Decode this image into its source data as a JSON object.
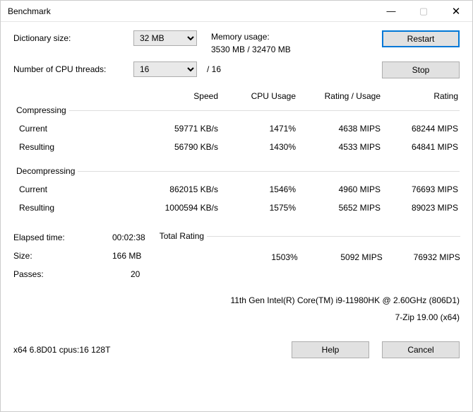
{
  "titlebar": {
    "text": "Benchmark"
  },
  "labels": {
    "dict_size": "Dictionary size:",
    "threads": "Number of CPU threads:",
    "memory_usage": "Memory usage:",
    "elapsed": "Elapsed time:",
    "size": "Size:",
    "passes": "Passes:"
  },
  "selects": {
    "dict_size": "32 MB",
    "threads": "16"
  },
  "memory": {
    "line": "3530 MB / 32470 MB"
  },
  "threads_total": "/ 16",
  "buttons": {
    "restart": "Restart",
    "stop": "Stop",
    "help": "Help",
    "cancel": "Cancel"
  },
  "headers": {
    "speed": "Speed",
    "cpu": "CPU Usage",
    "ratio": "Rating / Usage",
    "rating": "Rating"
  },
  "groups": {
    "compressing": "Compressing",
    "decompressing": "Decompressing",
    "total": "Total Rating",
    "current": "Current",
    "resulting": "Resulting"
  },
  "compressing": {
    "current": {
      "speed": "59771 KB/s",
      "cpu": "1471%",
      "ratio": "4638 MIPS",
      "rating": "68244 MIPS"
    },
    "resulting": {
      "speed": "56790 KB/s",
      "cpu": "1430%",
      "ratio": "4533 MIPS",
      "rating": "64841 MIPS"
    }
  },
  "decompressing": {
    "current": {
      "speed": "862015 KB/s",
      "cpu": "1546%",
      "ratio": "4960 MIPS",
      "rating": "76693 MIPS"
    },
    "resulting": {
      "speed": "1000594 KB/s",
      "cpu": "1575%",
      "ratio": "5652 MIPS",
      "rating": "89023 MIPS"
    }
  },
  "total": {
    "cpu": "1503%",
    "ratio": "5092 MIPS",
    "rating": "76932 MIPS"
  },
  "stats": {
    "elapsed": "00:02:38",
    "size": "166 MB",
    "passes": "20"
  },
  "info": {
    "cpu_line": "11th Gen Intel(R) Core(TM) i9-11980HK @ 2.60GHz (806D1)",
    "version": "7-Zip 19.00 (x64)"
  },
  "footer": {
    "build": "x64 6.8D01 cpus:16 128T"
  }
}
